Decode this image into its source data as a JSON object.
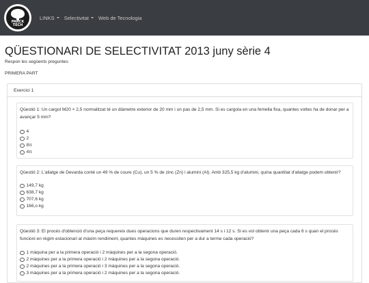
{
  "navbar": {
    "logo_text": "PARCK\nTECH",
    "items": [
      {
        "label": "LINKS",
        "dropdown": true
      },
      {
        "label": "Selectivitat",
        "dropdown": true
      },
      {
        "label": "Web de Tecnologia",
        "dropdown": false
      }
    ]
  },
  "page": {
    "title": "QÜESTIONARI DE SELECTIVITAT 2013 juny sèrie 4",
    "intro": "Respon les següents preguntes",
    "section": "PRIMERA PART"
  },
  "exercise": {
    "heading": "Exercici 1",
    "questions": [
      {
        "text": "Qüestió 1: Un cargol M20 × 2,5 normalitzat té un diàmetre exterior de 20 mm i un pas de 2,5 mm. Si es cargola en una femella fixa, quantes voltes ha de donar per a avançar 5 mm?",
        "options": [
          "4",
          "2",
          "8π",
          "4π"
        ]
      },
      {
        "text": "Qüestió 2: L'aliatge de Devarda conté un 49 % de coure (Cu), un 5 % de zinc (Zn) i alumini (Al). Amb 325,5 kg d'alumini, quina quantitat d'aliatge podem obtenir?",
        "options": [
          "149,7 kg",
          "638,7 kg",
          "707,6 kg",
          "166,o kg"
        ]
      },
      {
        "text": "Qüestió 3: El procés d'obtenció d'una peça requereix dues operacions que duren respectivament 14 s i 12 s. Si es vol obtenir una peça cada 6 s quan el procés funcioni en règim estacionari al màxim rendiment, quantes màquines es necessiten per a dur a terme cada operació?",
        "options": [
          "1 màquina per a la primera operació i 2 màquines per a la segona operació.",
          "2 màquines per a la primera operació i 2 màquines per a la segona operació.",
          "2 màquines per a la primera operació i 3 màquines per a la segona operació.",
          "3 màquines per a la primera operació i 2 màquines per a la segona operació."
        ]
      }
    ]
  }
}
